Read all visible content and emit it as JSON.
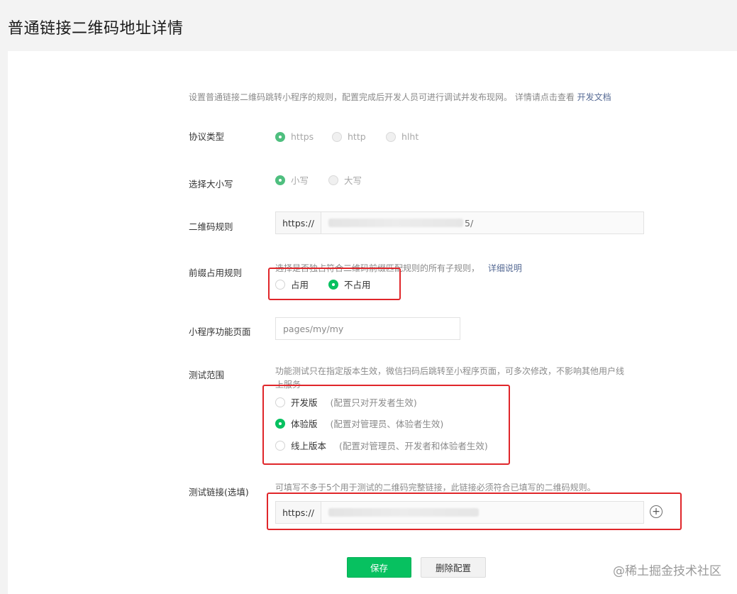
{
  "page": {
    "title": "普通链接二维码地址详情"
  },
  "intro": {
    "text": "设置普通链接二维码跳转小程序的规则，配置完成后开发人员可进行调试并发布现网。 详情请点击查看",
    "link": "开发文档"
  },
  "protocol": {
    "label": "协议类型",
    "options": [
      "https",
      "http",
      "hlht"
    ],
    "selected": "https"
  },
  "case": {
    "label": "选择大小写",
    "options": [
      "小写",
      "大写"
    ],
    "selected": "小写"
  },
  "qr_rule": {
    "label": "二维码规则",
    "prefix": "https://",
    "suffix": "5/"
  },
  "prefix_rule": {
    "label": "前缀占用规则",
    "desc": "选择是否独占符合二维码前缀匹配规则的所有子规则，",
    "link": "详细说明",
    "options": [
      "占用",
      "不占用"
    ],
    "selected": "不占用"
  },
  "page_path": {
    "label": "小程序功能页面",
    "value": "pages/my/my"
  },
  "test_scope": {
    "label": "测试范围",
    "desc_line1": "功能测试只在指定版本生效，微信扫码后跳转至小程序页面，可多次修改，不影响其他用户线",
    "desc_line2": "上服务",
    "options": [
      {
        "name": "开发版",
        "hint": "(配置只对开发者生效)"
      },
      {
        "name": "体验版",
        "hint": "(配置对管理员、体验者生效)"
      },
      {
        "name": "线上版本",
        "hint": "(配置对管理员、开发者和体验者生效)"
      }
    ],
    "selected": "体验版"
  },
  "test_link": {
    "label": "测试链接(选填)",
    "desc": "可填写不多于5个用于测试的二维码完整链接，此链接必须符合已填写的二维码规则。",
    "prefix": "https://",
    "add_symbol": "+"
  },
  "actions": {
    "save": "保存",
    "delete": "删除配置"
  },
  "watermark": "@稀土掘金技术社区",
  "colors": {
    "primary_green": "#07c160",
    "link_blue": "#576b95",
    "highlight_red": "#e0262a"
  },
  "icons": {
    "add": "plus-circle-icon"
  }
}
